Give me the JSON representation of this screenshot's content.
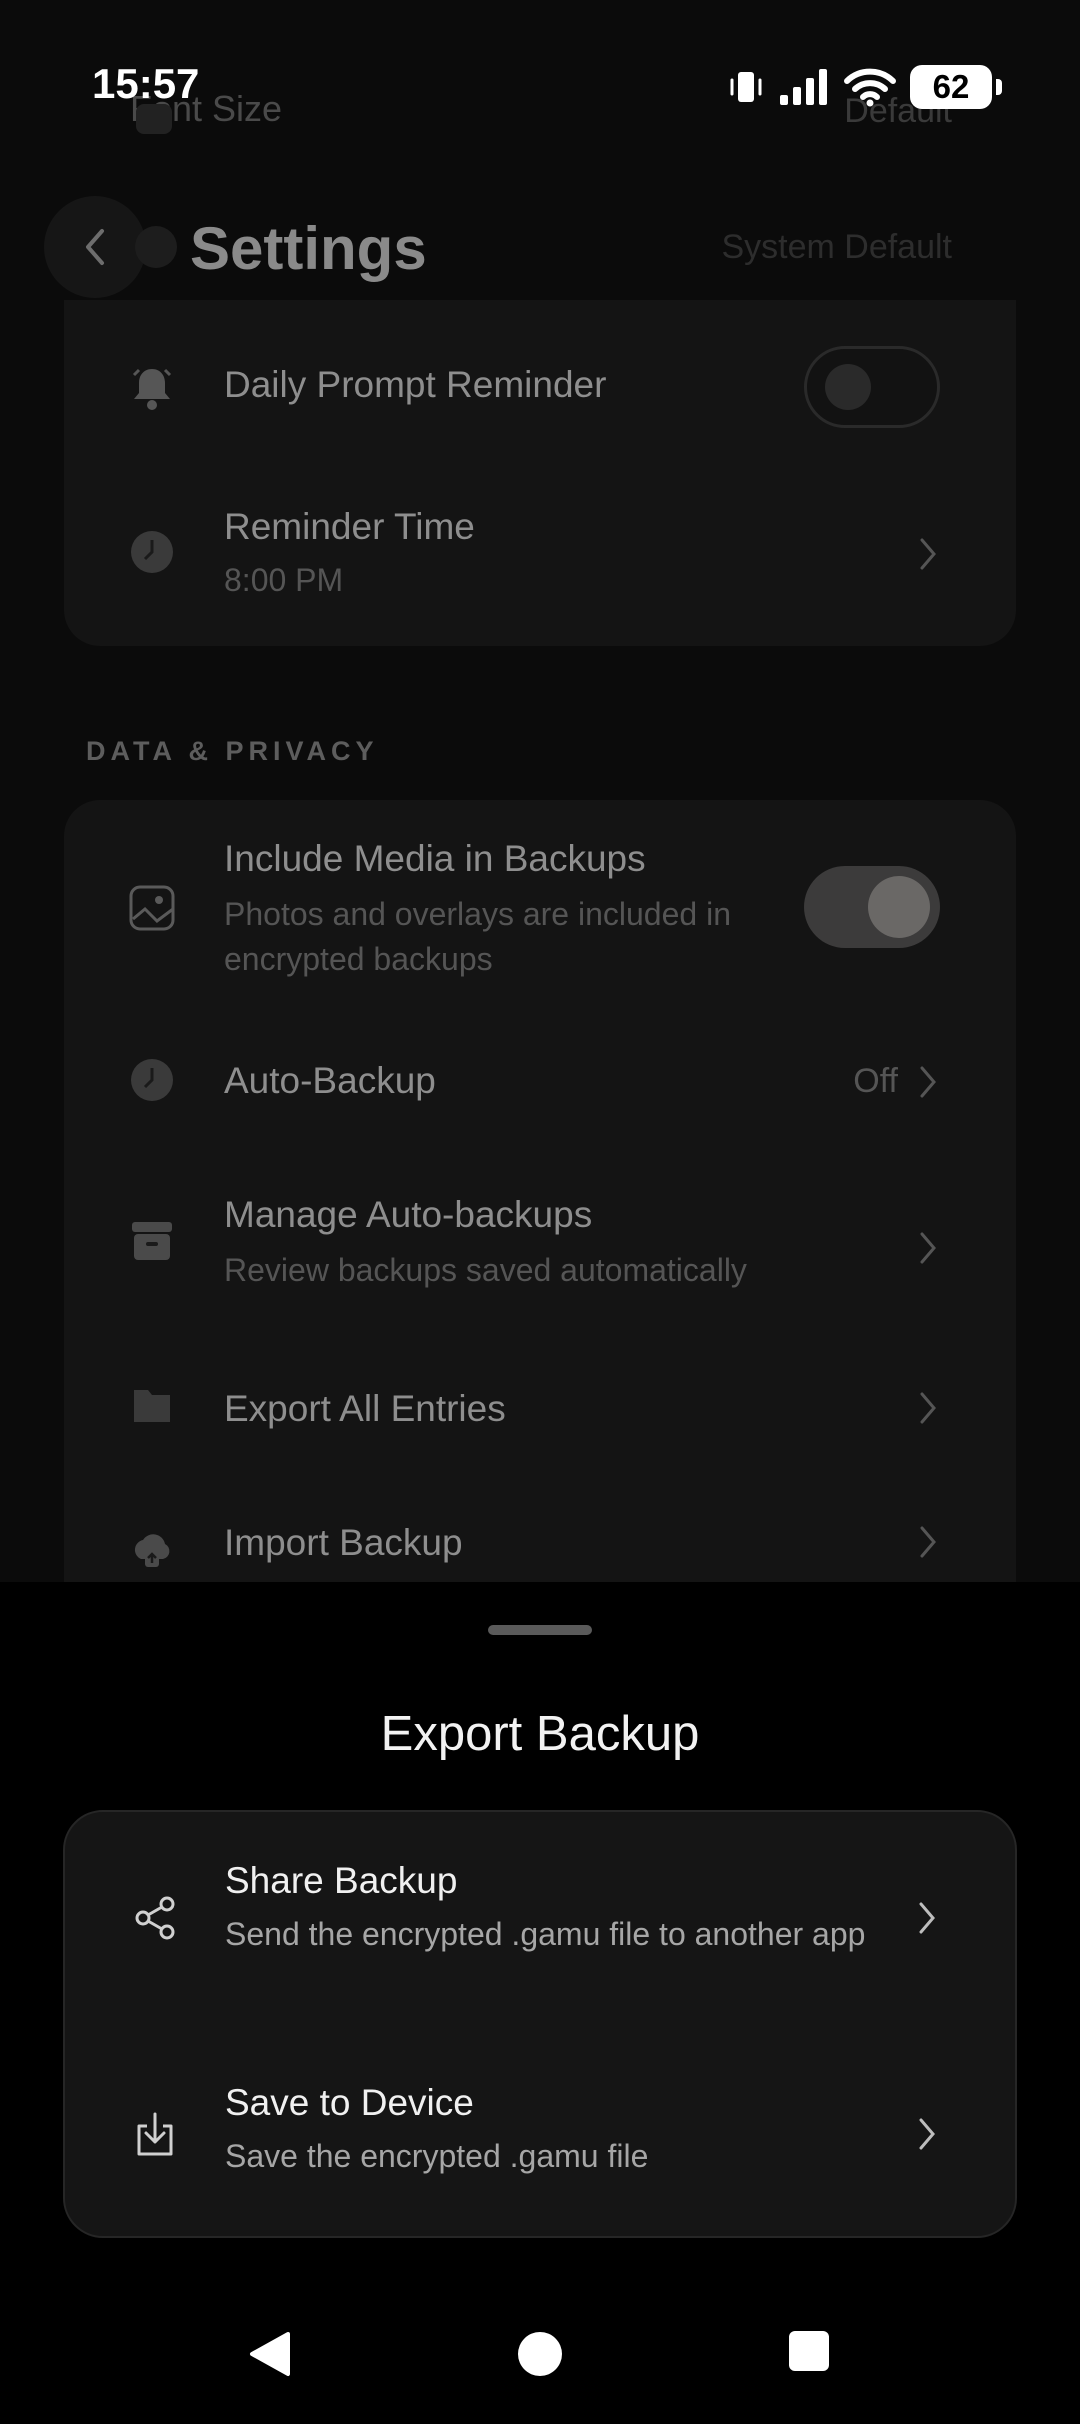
{
  "status_bar": {
    "time": "15:57",
    "battery": "62"
  },
  "background": {
    "partial_row": {
      "label": "Font Size",
      "value": "Default"
    },
    "title": "Settings",
    "title_right": "System Default",
    "reminders": {
      "daily_prompt": {
        "label": "Daily Prompt Reminder",
        "toggle": false
      },
      "reminder_time": {
        "label": "Reminder Time",
        "value": "8:00 PM"
      }
    },
    "data_privacy": {
      "section_label": "DATA & PRIVACY",
      "include_media": {
        "label": "Include Media in Backups",
        "description": "Photos and overlays are included in encrypted backups",
        "toggle": true
      },
      "auto_backup": {
        "label": "Auto-Backup",
        "value": "Off"
      },
      "manage_auto_backups": {
        "label": "Manage Auto-backups",
        "description": "Review backups saved automatically"
      },
      "export_all": {
        "label": "Export All Entries"
      },
      "import_backup": {
        "label": "Import Backup"
      }
    }
  },
  "sheet": {
    "title": "Export Backup",
    "options": [
      {
        "label": "Share Backup",
        "description": "Send the encrypted .gamu file to another app",
        "icon": "share-icon"
      },
      {
        "label": "Save to Device",
        "description": "Save the encrypted .gamu file",
        "icon": "download-icon"
      }
    ]
  },
  "nav_bar": {
    "icons": [
      "back-triangle-icon",
      "home-circle-icon",
      "recents-square-icon"
    ]
  }
}
